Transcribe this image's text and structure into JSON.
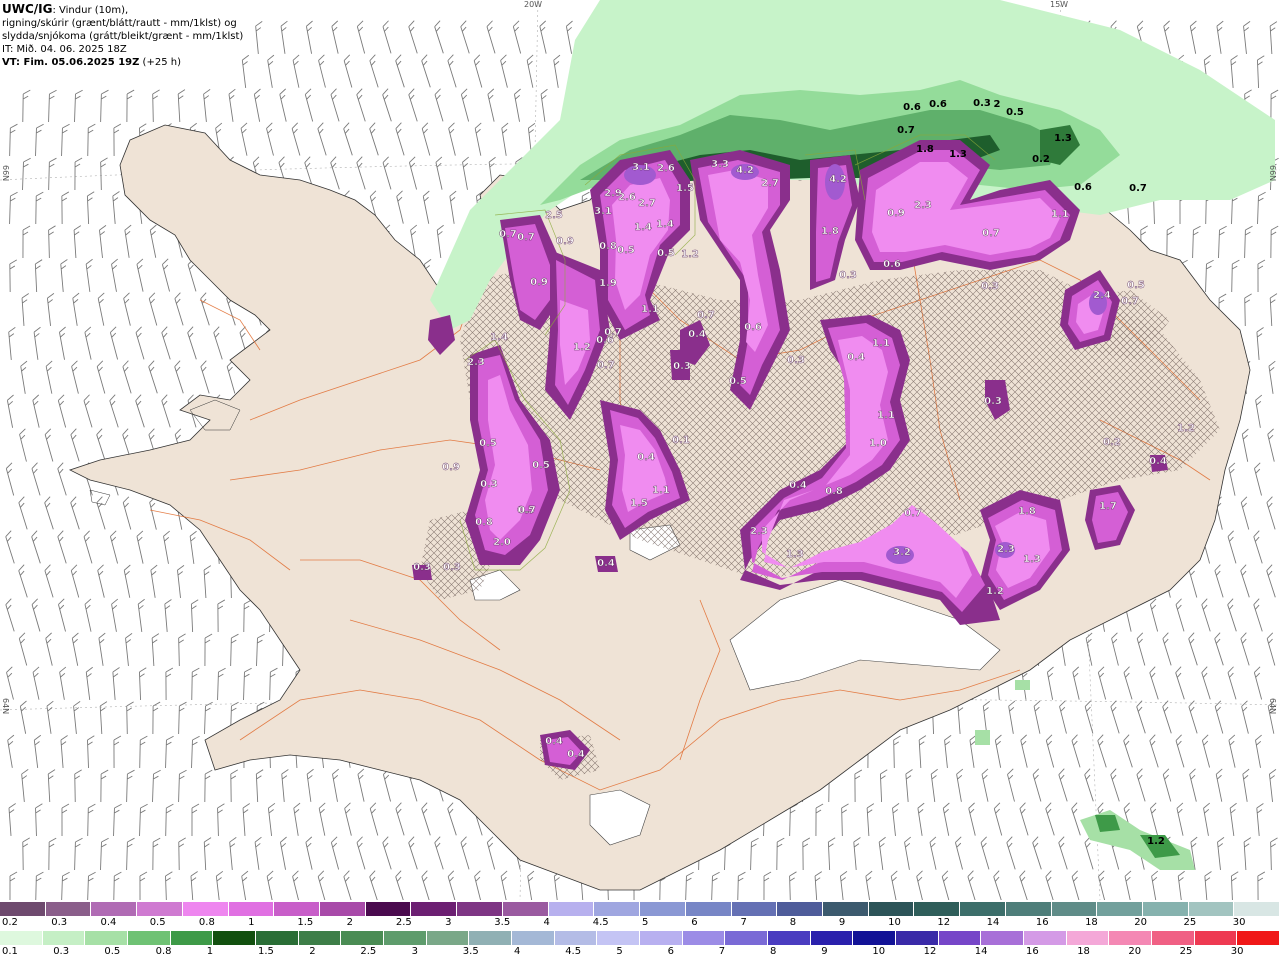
{
  "header": {
    "line1_bold": "UWC/IG",
    "line1_rest": ": Vindur (10m),",
    "line2": "rigning/skúrir (grænt/blátt/rautt - mm/1klst) og",
    "line3": "slydda/snjókoma (grátt/bleikt/grænt - mm/1klst)",
    "line4": "IT: Mið. 04. 06. 2025 18Z",
    "line5_bold": "VT: Fim. 05.06.2025 19Z",
    "line5_rest": " (+25 h)"
  },
  "axis_labels": {
    "lon_20w": "20W",
    "lon_15w": "15W",
    "lat_66n_left": "66N",
    "lat_66n_right": "66N",
    "lat_64n_left": "64N",
    "lat_64n_right": "64N"
  },
  "colors": {
    "land": "#efe3d6",
    "sea": "#ffffff",
    "roads": "#e06a2c",
    "snow_light": "#e9a8ea",
    "snow_mid": "#d45fd5",
    "snow_dark": "#8a2f8c",
    "rain_light": "#c7f3c9",
    "rain_mid": "#6cc479",
    "rain_dark": "#1e5e2c"
  },
  "precip_values": [
    {
      "t": "0.6"
    },
    {
      "t": "0.6"
    },
    {
      "t": "0.3"
    },
    {
      "t": "2"
    },
    {
      "t": "0.5"
    },
    {
      "t": "0.7"
    },
    {
      "t": "1.8"
    },
    {
      "t": "1.3"
    },
    {
      "t": "0.2"
    },
    {
      "t": "1.3"
    },
    {
      "t": "0.6"
    },
    {
      "t": "0.7"
    },
    {
      "t": "3.1"
    },
    {
      "t": "2.6"
    },
    {
      "t": "3.3"
    },
    {
      "t": "4.2"
    },
    {
      "t": "2.7"
    },
    {
      "t": "4.2"
    },
    {
      "t": "2.9"
    },
    {
      "t": "2.6"
    },
    {
      "t": "2.7"
    },
    {
      "t": "3.1"
    },
    {
      "t": "1.5"
    },
    {
      "t": "0.9"
    },
    {
      "t": "2.3"
    },
    {
      "t": "0.7"
    },
    {
      "t": "0.7"
    },
    {
      "t": "2.5"
    },
    {
      "t": "1.4"
    },
    {
      "t": "1.4"
    },
    {
      "t": "0.8"
    },
    {
      "t": "0.5"
    },
    {
      "t": "0.5"
    },
    {
      "t": "1.2"
    },
    {
      "t": "1.8"
    },
    {
      "t": "0.9"
    },
    {
      "t": "1.1"
    },
    {
      "t": "0.7"
    },
    {
      "t": "0.6"
    },
    {
      "t": "0.3"
    },
    {
      "t": "0.9"
    },
    {
      "t": "1.9"
    },
    {
      "t": "1.1"
    },
    {
      "t": "0.6"
    },
    {
      "t": "0.7"
    },
    {
      "t": "0.4"
    },
    {
      "t": "0.7"
    },
    {
      "t": "0.3"
    },
    {
      "t": "0.6"
    },
    {
      "t": "0.5"
    },
    {
      "t": "0.3"
    },
    {
      "t": "0.4"
    },
    {
      "t": "0.3"
    },
    {
      "t": "2.4"
    },
    {
      "t": "0.5"
    },
    {
      "t": "0.7"
    },
    {
      "t": "1.4"
    },
    {
      "t": "2.3"
    },
    {
      "t": "1.2"
    },
    {
      "t": "0.7"
    },
    {
      "t": "1.2"
    },
    {
      "t": "0.2"
    },
    {
      "t": "0.5"
    },
    {
      "t": "0.5"
    },
    {
      "t": "0.3"
    },
    {
      "t": "0.5"
    },
    {
      "t": "1.1"
    },
    {
      "t": "1.1"
    },
    {
      "t": "1.0"
    },
    {
      "t": "0.4"
    },
    {
      "t": "0.4"
    },
    {
      "t": "1.1"
    },
    {
      "t": "1.5"
    },
    {
      "t": "0.1"
    },
    {
      "t": "0.4"
    },
    {
      "t": "0.8"
    },
    {
      "t": "0.7"
    },
    {
      "t": "1.8"
    },
    {
      "t": "1.7"
    },
    {
      "t": "2.3"
    },
    {
      "t": "1.3"
    },
    {
      "t": "3.2"
    },
    {
      "t": "1.3"
    },
    {
      "t": "2.3"
    },
    {
      "t": "1.2"
    },
    {
      "t": "0.4"
    },
    {
      "t": "0.3"
    },
    {
      "t": "2.0"
    },
    {
      "t": "0.8"
    },
    {
      "t": "0.7"
    },
    {
      "t": "0.3"
    },
    {
      "t": "0.4"
    },
    {
      "t": "0.4"
    },
    {
      "t": "0.3"
    },
    {
      "t": "1.2"
    },
    {
      "t": "0.9"
    }
  ],
  "legend_snow": {
    "colors": [
      "#6e4a6e",
      "#8a5e8a",
      "#b06bb4",
      "#cf7ad1",
      "#ee86ef",
      "#e070e2",
      "#c85ec9",
      "#a84aa9",
      "#4a0a4e",
      "#6c1f72",
      "#7e3584",
      "#9a5aa0",
      "#b7b0ee",
      "#9fa6e0",
      "#8a98d4",
      "#7786c6",
      "#6470b4",
      "#4e5c9a",
      "#3c5a6e",
      "#2c5458",
      "#2f5e5a",
      "#3c6e6a",
      "#4e7e7a",
      "#5f8c88",
      "#72a09c",
      "#86b2ae",
      "#a2c4c0",
      "#d8e6e4"
    ],
    "ticks": [
      "0.2",
      "0.3",
      "0.4",
      "0.5",
      "0.8",
      "1",
      "1.5",
      "2",
      "2.5",
      "3",
      "3.5",
      "4",
      "4.5",
      "5",
      "6",
      "7",
      "8",
      "9",
      "10",
      "12",
      "14",
      "16",
      "18",
      "20",
      "25",
      "30"
    ]
  },
  "legend_rain": {
    "colors": [
      "#def8de",
      "#c5efc5",
      "#a6e0a6",
      "#6fc274",
      "#3e9a48",
      "#12500f",
      "#2a6e36",
      "#3d7e48",
      "#4a8c54",
      "#5e9c6c",
      "#7aa888",
      "#90b0b4",
      "#a4b8d6",
      "#b4bce6",
      "#c4c4f4",
      "#b8b0f0",
      "#9c8ce6",
      "#7a6ad6",
      "#4a3cc0",
      "#2a20ac",
      "#121296",
      "#3a2aa8",
      "#7646c8",
      "#a870d8",
      "#d49ae6",
      "#f4a8d8",
      "#f488b4",
      "#f06084",
      "#ee3a52",
      "#f01818"
    ],
    "ticks": [
      "0.1",
      "0.3",
      "0.5",
      "0.8",
      "1",
      "1.5",
      "2",
      "2.5",
      "3",
      "3.5",
      "4",
      "4.5",
      "5",
      "6",
      "7",
      "8",
      "9",
      "10",
      "12",
      "14",
      "16",
      "18",
      "20",
      "25",
      "30"
    ]
  }
}
